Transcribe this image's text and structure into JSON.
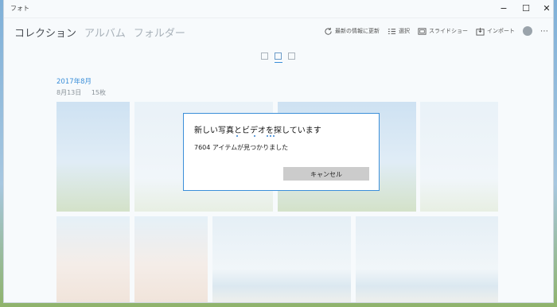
{
  "window": {
    "title": "フォト"
  },
  "nav": {
    "items": [
      "コレクション",
      "アルバム",
      "フォルダー"
    ]
  },
  "commands": {
    "refresh": "最新の情報に更新",
    "select": "選択",
    "slideshow": "スライドショー",
    "import": "インポート",
    "more": "⋯"
  },
  "collection": {
    "month": "2017年8月",
    "date": "8月13日",
    "count": "15枚"
  },
  "dialog": {
    "title": "新しい写真とビデオを探しています",
    "status": "7604 アイテムが見つかりました",
    "cancel_label": "キャンセル"
  },
  "colors": {
    "accent": "#3b8fd9",
    "button": "#cccccc"
  },
  "icons": [
    "refresh-icon",
    "select-icon",
    "slideshow-icon",
    "import-icon",
    "account-icon",
    "more-icon"
  ]
}
